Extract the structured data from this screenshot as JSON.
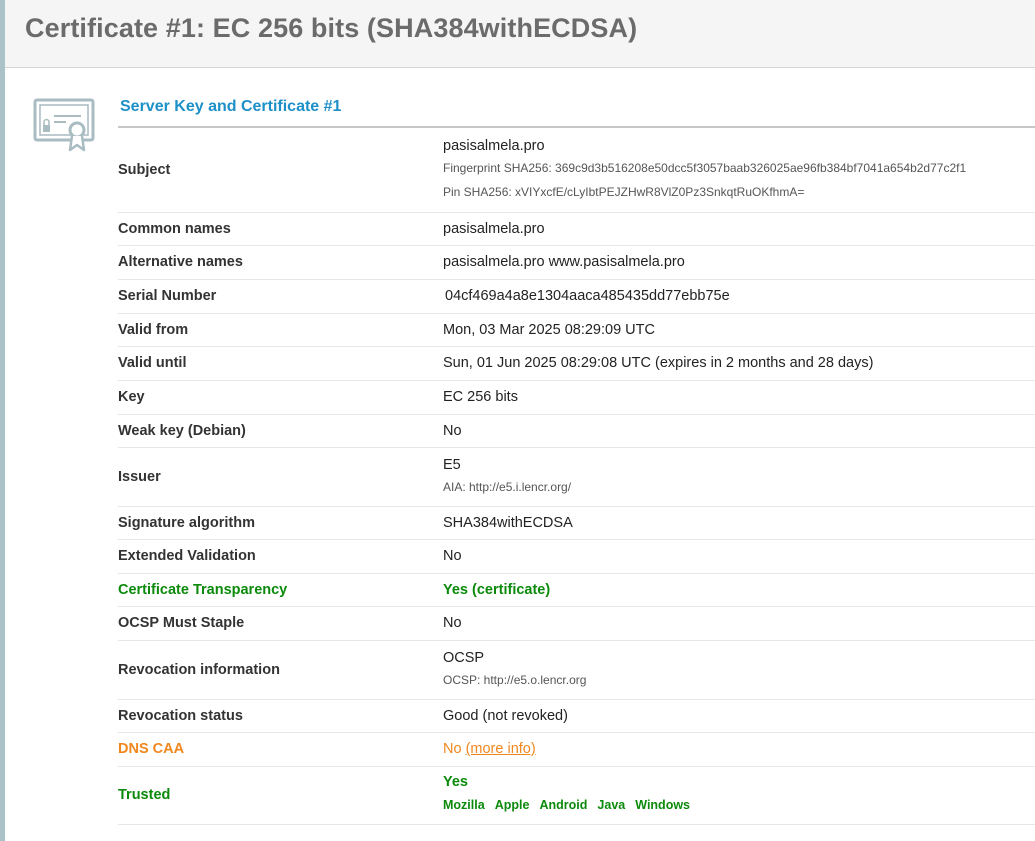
{
  "header": {
    "title": "Certificate #1: EC 256 bits (SHA384withECDSA)"
  },
  "section": {
    "title": "Server Key and Certificate #1"
  },
  "rows": {
    "subject": {
      "label": "Subject",
      "value": "pasisalmela.pro",
      "fingerprint": "Fingerprint SHA256: 369c9d3b516208e50dcc5f3057baab326025ae96fb384bf7041a654b2d77c2f1",
      "pin": "Pin SHA256: xVIYxcfE/cLyIbtPEJZHwR8VlZ0Pz3SnkqtRuOKfhmA="
    },
    "common_names": {
      "label": "Common names",
      "value": "pasisalmela.pro"
    },
    "alternative_names": {
      "label": "Alternative names",
      "value": "pasisalmela.pro www.pasisalmela.pro"
    },
    "serial_number": {
      "label": "Serial Number",
      "value": "04cf469a4a8e1304aaca485435dd77ebb75e"
    },
    "valid_from": {
      "label": "Valid from",
      "value": "Mon, 03 Mar 2025 08:29:09 UTC"
    },
    "valid_until": {
      "label": "Valid until",
      "value": "Sun, 01 Jun 2025 08:29:08 UTC (expires in 2 months and 28 days)"
    },
    "key": {
      "label": "Key",
      "value": "EC 256 bits"
    },
    "weak_key": {
      "label": "Weak key (Debian)",
      "value": "No"
    },
    "issuer": {
      "label": "Issuer",
      "value": "E5",
      "aia": "AIA: http://e5.i.lencr.org/"
    },
    "signature_algorithm": {
      "label": "Signature algorithm",
      "value": "SHA384withECDSA"
    },
    "extended_validation": {
      "label": "Extended Validation",
      "value": "No"
    },
    "certificate_transparency": {
      "label": "Certificate Transparency",
      "value": "Yes (certificate)"
    },
    "ocsp_must_staple": {
      "label": "OCSP Must Staple",
      "value": "No"
    },
    "revocation_information": {
      "label": "Revocation information",
      "value": "OCSP",
      "ocsp": "OCSP: http://e5.o.lencr.org"
    },
    "revocation_status": {
      "label": "Revocation status",
      "value": "Good (not revoked)"
    },
    "dns_caa": {
      "label": "DNS CAA",
      "value": "No",
      "link": "(more info)"
    },
    "trusted": {
      "label": "Trusted",
      "value": "Yes",
      "browsers": [
        "Mozilla",
        "Apple",
        "Android",
        "Java",
        "Windows"
      ]
    }
  },
  "colors": {
    "accent_blue": "#1e90c8",
    "ok_green": "#0b8a0b",
    "warn_orange": "#f0871e",
    "title_gray": "#6b6b6b"
  },
  "icons": {
    "certificate": "certificate-icon"
  }
}
